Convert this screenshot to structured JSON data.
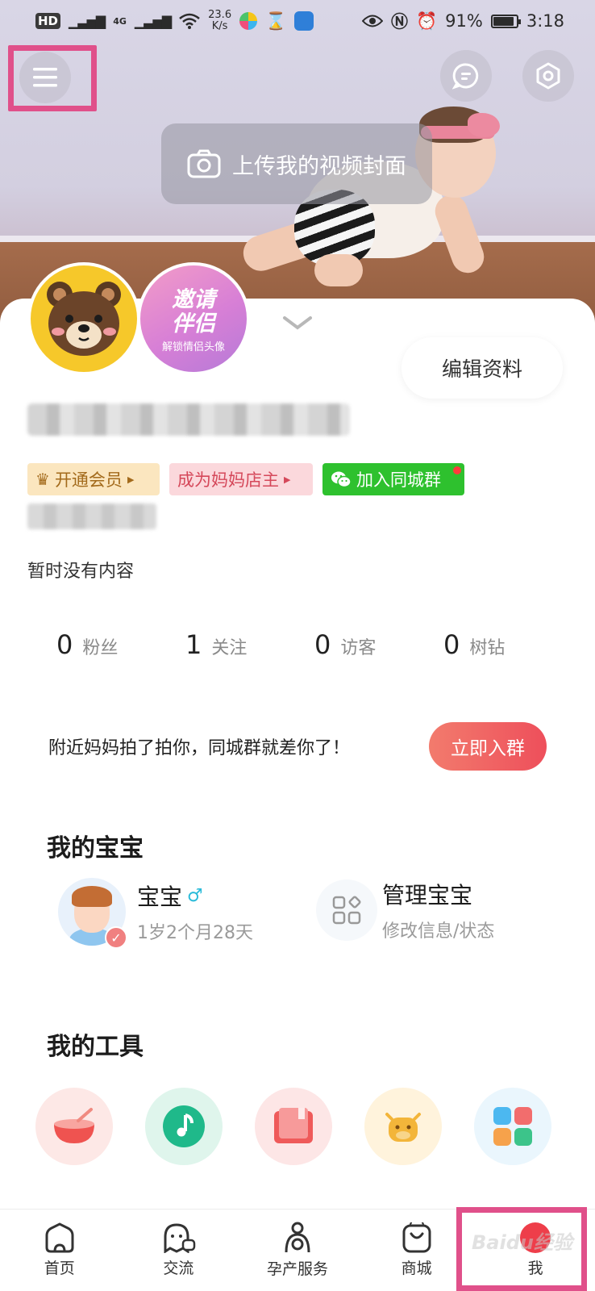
{
  "status_bar": {
    "network_badge": "HD",
    "network_type": "4G",
    "speed_value": "23.6",
    "speed_unit": "K/s",
    "battery": "91%",
    "time": "3:18",
    "battery_level": 0.91
  },
  "header": {
    "upload_label": "上传我的视频封面"
  },
  "profile": {
    "invite_title_1": "邀请",
    "invite_title_2": "伴侣",
    "invite_sub": "解锁情侣头像",
    "edit_label": "编辑资料",
    "tags": {
      "vip": "开通会员",
      "shop": "成为妈妈店主",
      "group": "加入同城群"
    },
    "empty_text": "暂时没有内容",
    "stats": [
      {
        "num": "0",
        "label": "粉丝"
      },
      {
        "num": "1",
        "label": "关注"
      },
      {
        "num": "0",
        "label": "访客"
      },
      {
        "num": "0",
        "label": "树钻"
      }
    ]
  },
  "promo": {
    "text": "附近妈妈拍了拍你，同城群就差你了！",
    "button": "立即入群"
  },
  "my_baby": {
    "title": "我的宝宝",
    "baby_name": "宝宝",
    "gender_symbol": "♂",
    "baby_age": "1岁2个月28天",
    "manage_title": "管理宝宝",
    "manage_sub": "修改信息/状态"
  },
  "my_tools": {
    "title": "我的工具",
    "items": [
      {
        "icon": "bowl-icon",
        "color": "#ef5350"
      },
      {
        "icon": "music-note-icon",
        "color": "#1fb98a"
      },
      {
        "icon": "book-icon",
        "color": "#ef5a5a"
      },
      {
        "icon": "cow-icon",
        "color": "#f3b53a"
      },
      {
        "icon": "apps-grid-icon",
        "color": "#4cb8f0"
      }
    ]
  },
  "bottom_nav": {
    "items": [
      {
        "label": "首页"
      },
      {
        "label": "交流"
      },
      {
        "label": "孕产服务"
      },
      {
        "label": "商城"
      },
      {
        "label": "我"
      }
    ]
  },
  "watermark": "Baidu经验",
  "colors": {
    "highlight": "#e0508a",
    "accent_red": "#ee4f5b",
    "wechat_green": "#2ec12e"
  }
}
